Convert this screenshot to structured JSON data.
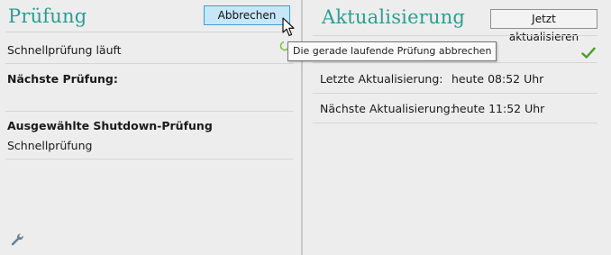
{
  "left": {
    "title": "Prüfung",
    "cancel_label": "Abbrechen",
    "cancel_tooltip": "Die gerade laufende Prüfung abbrechen",
    "status_text": "Schnellprüfung läuft",
    "next_check_label": "Nächste Prüfung:",
    "shutdown_heading": "Ausgewählte Shutdown-Prüfung",
    "shutdown_value": "Schnellprüfung"
  },
  "right": {
    "title": "Aktualisierung",
    "update_now_label": "Jetzt aktualisieren",
    "last_update_label": "Letzte Aktualisierung:",
    "last_update_value": "heute 08:52 Uhr",
    "next_update_label": "Nächste Aktualisierung:",
    "next_update_value": "heute 11:52 Uhr"
  },
  "icons": {
    "spinner": "spinner-icon",
    "check": "checkmark-icon",
    "wrench": "wrench-icon",
    "cursor": "mouse-pointer-icon"
  },
  "colors": {
    "title": "#2a9e94",
    "cancel_bg": "#c7e6f8",
    "check": "#4a9d2a"
  }
}
